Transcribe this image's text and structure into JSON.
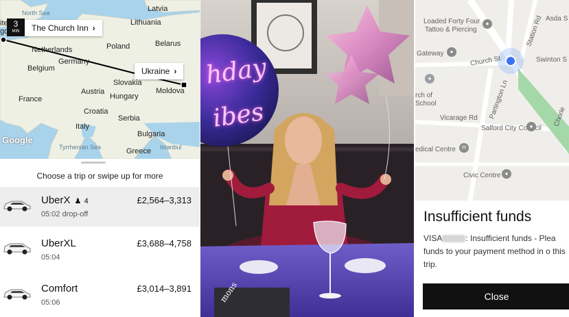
{
  "left": {
    "map": {
      "labels": {
        "north_sea": "North Sea",
        "latvia": "Latvia",
        "lithuania": "Lithuania",
        "belarus": "Belarus",
        "poland": "Poland",
        "netherlands": "Netherlands",
        "germany": "Germany",
        "belgium": "Belgium",
        "slovakia": "Slovakia",
        "moldova": "Moldova",
        "france": "France",
        "austria": "Austria",
        "hungary": "Hungary",
        "croatia": "Croatia",
        "serbia": "Serbia",
        "italy": "Italy",
        "bulgaria": "Bulgaria",
        "tyrrhenian_sea": "Tyrrhenian Sea",
        "istanbul": "Istanbul",
        "greece": "Greece",
        "edge_top": "ite",
        "edge_mid": "gd"
      },
      "eta_number": "3",
      "eta_unit": "MIN",
      "pickup_callout": "The Church Inn",
      "dropoff_callout": "Ukraine",
      "callout_chevron": "›",
      "google_logo": "Google"
    },
    "sheet": {
      "prompt": "Choose a trip or swipe up for more",
      "trips": [
        {
          "name": "UberX",
          "seats": "4",
          "sub": "05:02 drop-off",
          "price": "£2,564–3,313"
        },
        {
          "name": "UberXL",
          "sub": "05:04",
          "price": "£3,688–4,758"
        },
        {
          "name": "Comfort",
          "sub": "05:06",
          "price": "£3,014–3,891"
        }
      ]
    }
  },
  "middle": {
    "balloon_line1": "hday",
    "balloon_line2": "ibes",
    "sign_text": "mons"
  },
  "right": {
    "map": {
      "labels": {
        "loaded_forty_four": "Loaded Forty Four",
        "tattoo": "Tattoo & Piercing",
        "asda": "Asda S",
        "gateway": "Gateway",
        "swinton": "Swinton S",
        "church_st": "Church St",
        "station_rd": "Station Rd",
        "rch_of": "rch of",
        "school": "School",
        "partington": "Partington Ln",
        "vicarage": "Vicarage Rd",
        "council": "Salford City Council",
        "medical": "edical Centre",
        "civic": "Civic Centre",
        "chorley": "Chorle"
      }
    },
    "sheet": {
      "title": "Insufficient funds",
      "message_prefix": "VISA",
      "message_suffix": ": Insufficient funds - Plea funds to your payment method in o this trip.",
      "close_label": "Close"
    }
  },
  "colors": {
    "sea": "#a9d3ea",
    "land": "#eef0e4",
    "route": "#000000",
    "button": "#111111",
    "location": "#3b74f3",
    "park": "#a5d8a8"
  }
}
